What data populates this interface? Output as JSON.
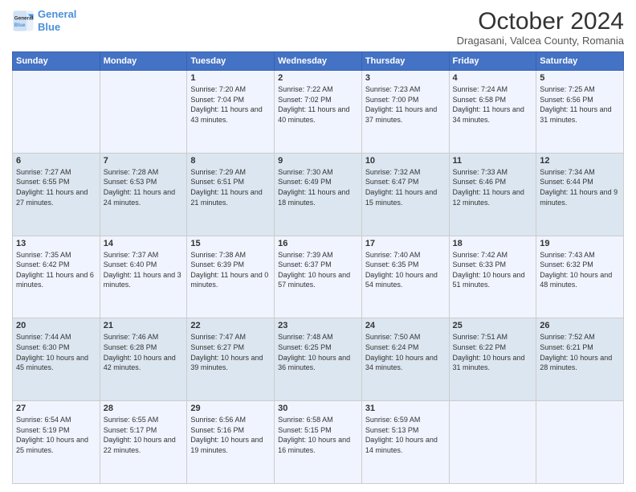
{
  "header": {
    "logo_line1": "General",
    "logo_line2": "Blue",
    "title": "October 2024",
    "subtitle": "Dragasani, Valcea County, Romania"
  },
  "weekdays": [
    "Sunday",
    "Monday",
    "Tuesday",
    "Wednesday",
    "Thursday",
    "Friday",
    "Saturday"
  ],
  "weeks": [
    [
      {
        "day": "",
        "sunrise": "",
        "sunset": "",
        "daylight": ""
      },
      {
        "day": "",
        "sunrise": "",
        "sunset": "",
        "daylight": ""
      },
      {
        "day": "1",
        "sunrise": "Sunrise: 7:20 AM",
        "sunset": "Sunset: 7:04 PM",
        "daylight": "Daylight: 11 hours and 43 minutes."
      },
      {
        "day": "2",
        "sunrise": "Sunrise: 7:22 AM",
        "sunset": "Sunset: 7:02 PM",
        "daylight": "Daylight: 11 hours and 40 minutes."
      },
      {
        "day": "3",
        "sunrise": "Sunrise: 7:23 AM",
        "sunset": "Sunset: 7:00 PM",
        "daylight": "Daylight: 11 hours and 37 minutes."
      },
      {
        "day": "4",
        "sunrise": "Sunrise: 7:24 AM",
        "sunset": "Sunset: 6:58 PM",
        "daylight": "Daylight: 11 hours and 34 minutes."
      },
      {
        "day": "5",
        "sunrise": "Sunrise: 7:25 AM",
        "sunset": "Sunset: 6:56 PM",
        "daylight": "Daylight: 11 hours and 31 minutes."
      }
    ],
    [
      {
        "day": "6",
        "sunrise": "Sunrise: 7:27 AM",
        "sunset": "Sunset: 6:55 PM",
        "daylight": "Daylight: 11 hours and 27 minutes."
      },
      {
        "day": "7",
        "sunrise": "Sunrise: 7:28 AM",
        "sunset": "Sunset: 6:53 PM",
        "daylight": "Daylight: 11 hours and 24 minutes."
      },
      {
        "day": "8",
        "sunrise": "Sunrise: 7:29 AM",
        "sunset": "Sunset: 6:51 PM",
        "daylight": "Daylight: 11 hours and 21 minutes."
      },
      {
        "day": "9",
        "sunrise": "Sunrise: 7:30 AM",
        "sunset": "Sunset: 6:49 PM",
        "daylight": "Daylight: 11 hours and 18 minutes."
      },
      {
        "day": "10",
        "sunrise": "Sunrise: 7:32 AM",
        "sunset": "Sunset: 6:47 PM",
        "daylight": "Daylight: 11 hours and 15 minutes."
      },
      {
        "day": "11",
        "sunrise": "Sunrise: 7:33 AM",
        "sunset": "Sunset: 6:46 PM",
        "daylight": "Daylight: 11 hours and 12 minutes."
      },
      {
        "day": "12",
        "sunrise": "Sunrise: 7:34 AM",
        "sunset": "Sunset: 6:44 PM",
        "daylight": "Daylight: 11 hours and 9 minutes."
      }
    ],
    [
      {
        "day": "13",
        "sunrise": "Sunrise: 7:35 AM",
        "sunset": "Sunset: 6:42 PM",
        "daylight": "Daylight: 11 hours and 6 minutes."
      },
      {
        "day": "14",
        "sunrise": "Sunrise: 7:37 AM",
        "sunset": "Sunset: 6:40 PM",
        "daylight": "Daylight: 11 hours and 3 minutes."
      },
      {
        "day": "15",
        "sunrise": "Sunrise: 7:38 AM",
        "sunset": "Sunset: 6:39 PM",
        "daylight": "Daylight: 11 hours and 0 minutes."
      },
      {
        "day": "16",
        "sunrise": "Sunrise: 7:39 AM",
        "sunset": "Sunset: 6:37 PM",
        "daylight": "Daylight: 10 hours and 57 minutes."
      },
      {
        "day": "17",
        "sunrise": "Sunrise: 7:40 AM",
        "sunset": "Sunset: 6:35 PM",
        "daylight": "Daylight: 10 hours and 54 minutes."
      },
      {
        "day": "18",
        "sunrise": "Sunrise: 7:42 AM",
        "sunset": "Sunset: 6:33 PM",
        "daylight": "Daylight: 10 hours and 51 minutes."
      },
      {
        "day": "19",
        "sunrise": "Sunrise: 7:43 AM",
        "sunset": "Sunset: 6:32 PM",
        "daylight": "Daylight: 10 hours and 48 minutes."
      }
    ],
    [
      {
        "day": "20",
        "sunrise": "Sunrise: 7:44 AM",
        "sunset": "Sunset: 6:30 PM",
        "daylight": "Daylight: 10 hours and 45 minutes."
      },
      {
        "day": "21",
        "sunrise": "Sunrise: 7:46 AM",
        "sunset": "Sunset: 6:28 PM",
        "daylight": "Daylight: 10 hours and 42 minutes."
      },
      {
        "day": "22",
        "sunrise": "Sunrise: 7:47 AM",
        "sunset": "Sunset: 6:27 PM",
        "daylight": "Daylight: 10 hours and 39 minutes."
      },
      {
        "day": "23",
        "sunrise": "Sunrise: 7:48 AM",
        "sunset": "Sunset: 6:25 PM",
        "daylight": "Daylight: 10 hours and 36 minutes."
      },
      {
        "day": "24",
        "sunrise": "Sunrise: 7:50 AM",
        "sunset": "Sunset: 6:24 PM",
        "daylight": "Daylight: 10 hours and 34 minutes."
      },
      {
        "day": "25",
        "sunrise": "Sunrise: 7:51 AM",
        "sunset": "Sunset: 6:22 PM",
        "daylight": "Daylight: 10 hours and 31 minutes."
      },
      {
        "day": "26",
        "sunrise": "Sunrise: 7:52 AM",
        "sunset": "Sunset: 6:21 PM",
        "daylight": "Daylight: 10 hours and 28 minutes."
      }
    ],
    [
      {
        "day": "27",
        "sunrise": "Sunrise: 6:54 AM",
        "sunset": "Sunset: 5:19 PM",
        "daylight": "Daylight: 10 hours and 25 minutes."
      },
      {
        "day": "28",
        "sunrise": "Sunrise: 6:55 AM",
        "sunset": "Sunset: 5:17 PM",
        "daylight": "Daylight: 10 hours and 22 minutes."
      },
      {
        "day": "29",
        "sunrise": "Sunrise: 6:56 AM",
        "sunset": "Sunset: 5:16 PM",
        "daylight": "Daylight: 10 hours and 19 minutes."
      },
      {
        "day": "30",
        "sunrise": "Sunrise: 6:58 AM",
        "sunset": "Sunset: 5:15 PM",
        "daylight": "Daylight: 10 hours and 16 minutes."
      },
      {
        "day": "31",
        "sunrise": "Sunrise: 6:59 AM",
        "sunset": "Sunset: 5:13 PM",
        "daylight": "Daylight: 10 hours and 14 minutes."
      },
      {
        "day": "",
        "sunrise": "",
        "sunset": "",
        "daylight": ""
      },
      {
        "day": "",
        "sunrise": "",
        "sunset": "",
        "daylight": ""
      }
    ]
  ]
}
